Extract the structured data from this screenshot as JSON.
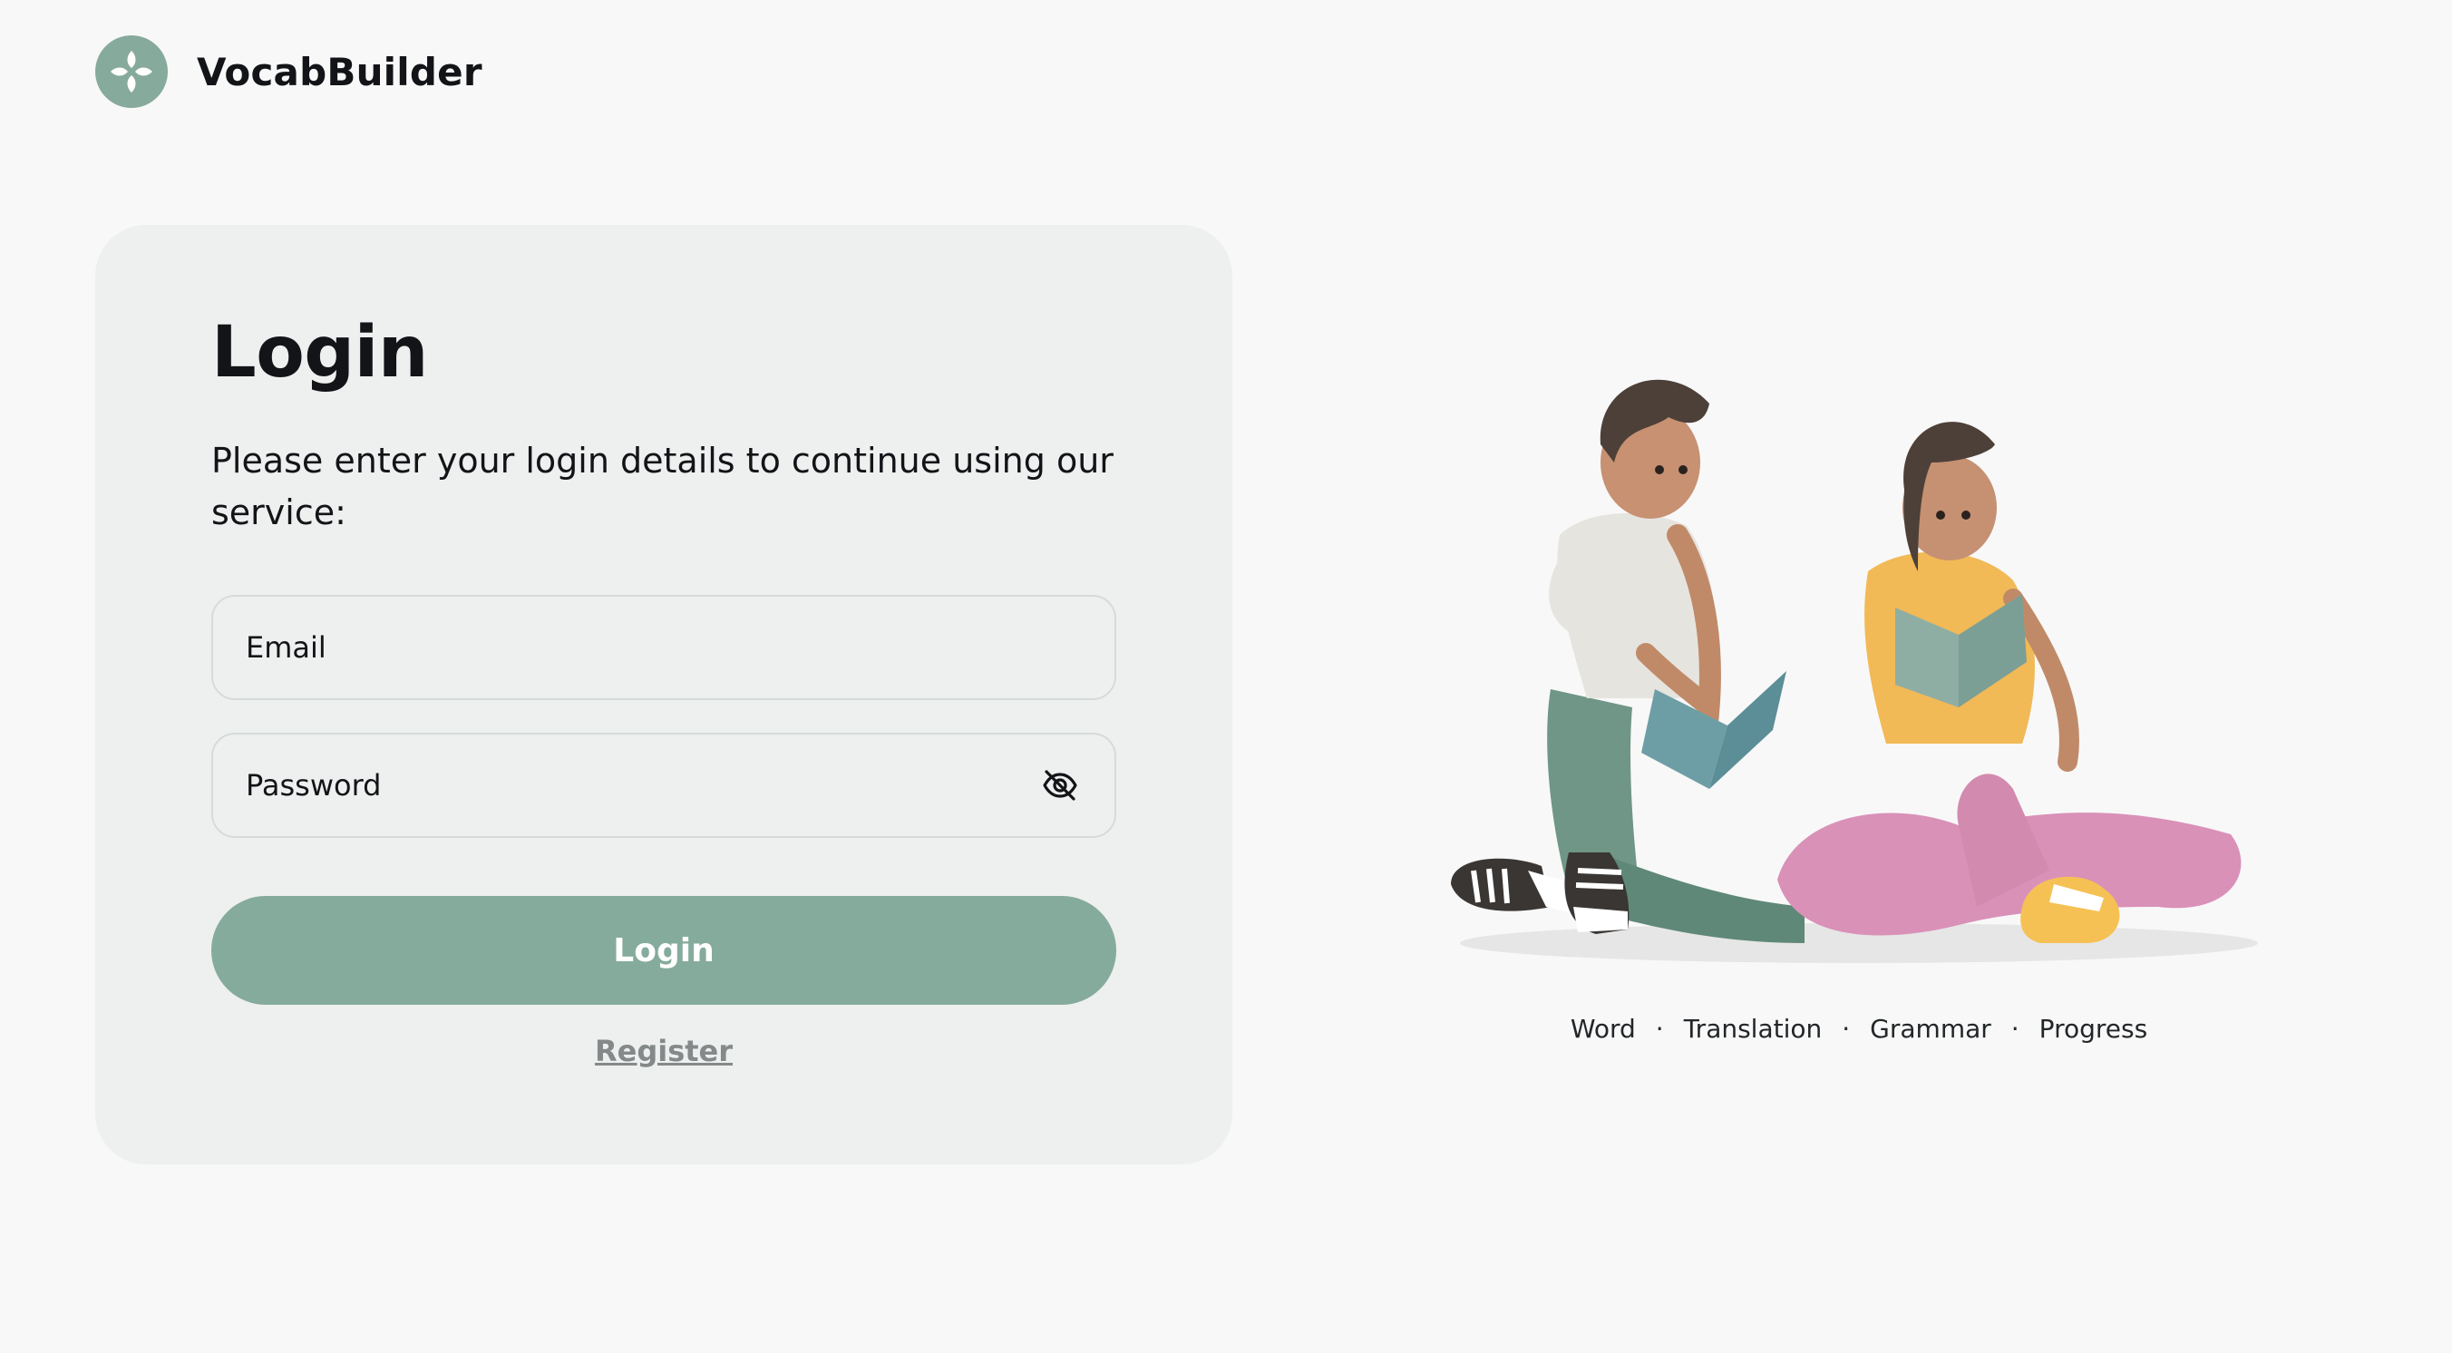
{
  "brand": {
    "name": "VocabBuilder",
    "logo_icon": "clover-icon",
    "accent": "#86aa9c"
  },
  "login": {
    "title": "Login",
    "subtitle": "Please enter your login details to continue using our service:",
    "email_placeholder": "Email",
    "password_placeholder": "Password",
    "password_toggle_icon": "eye-slash-icon",
    "submit_label": "Login",
    "register_label": "Register"
  },
  "hero": {
    "illustration": "two-people-reading-books",
    "tags": [
      "Word",
      "Translation",
      "Grammar",
      "Progress"
    ],
    "separator": "·"
  },
  "colors": {
    "background": "#f8f8f8",
    "card": "#edf0ef",
    "button": "#85ab9c",
    "text": "#121417"
  }
}
